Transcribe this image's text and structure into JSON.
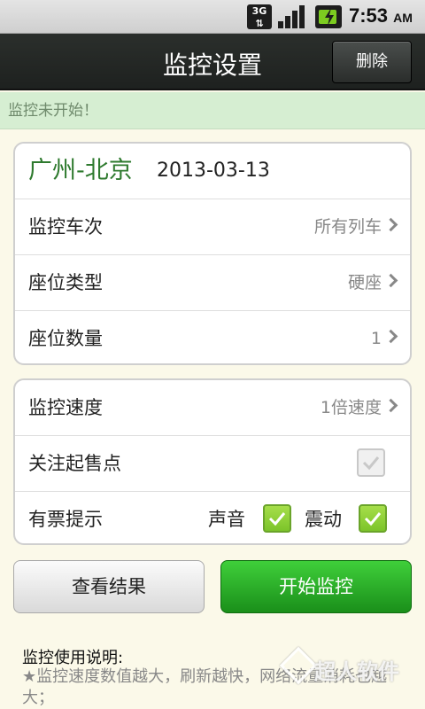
{
  "status_bar": {
    "network": "3G",
    "time": "7:53",
    "ampm": "AM",
    "icons": [
      "3g-icon",
      "signal-icon",
      "battery-charging-icon"
    ]
  },
  "header": {
    "title": "监控设置",
    "delete_label": "删除"
  },
  "notice": "监控未开始！",
  "trip": {
    "route": "广州-北京",
    "date": "2013-03-13"
  },
  "settings": [
    {
      "label": "监控车次",
      "value": "所有列车"
    },
    {
      "label": "座位类型",
      "value": "硬座"
    },
    {
      "label": "座位数量",
      "value": "1"
    }
  ],
  "monitor": {
    "speed_label": "监控速度",
    "speed_value": "1倍速度",
    "follow_label": "关注起售点",
    "follow_checked": false,
    "ticket_label": "有票提示",
    "sound_label": "声音",
    "sound_checked": true,
    "vibrate_label": "震动",
    "vibrate_checked": true
  },
  "actions": {
    "results_label": "查看结果",
    "start_label": "开始监控"
  },
  "help": {
    "title": "监控使用说明:",
    "text": "★监控速度数值越大，刷新越快，网络流量消耗也越大；"
  },
  "watermark": "超人软件",
  "colors": {
    "route_green": "#2e7a2e",
    "start_button": "#1a8f1a",
    "notice_bg": "#d6eed2",
    "page_bg": "#fbf9e9"
  }
}
